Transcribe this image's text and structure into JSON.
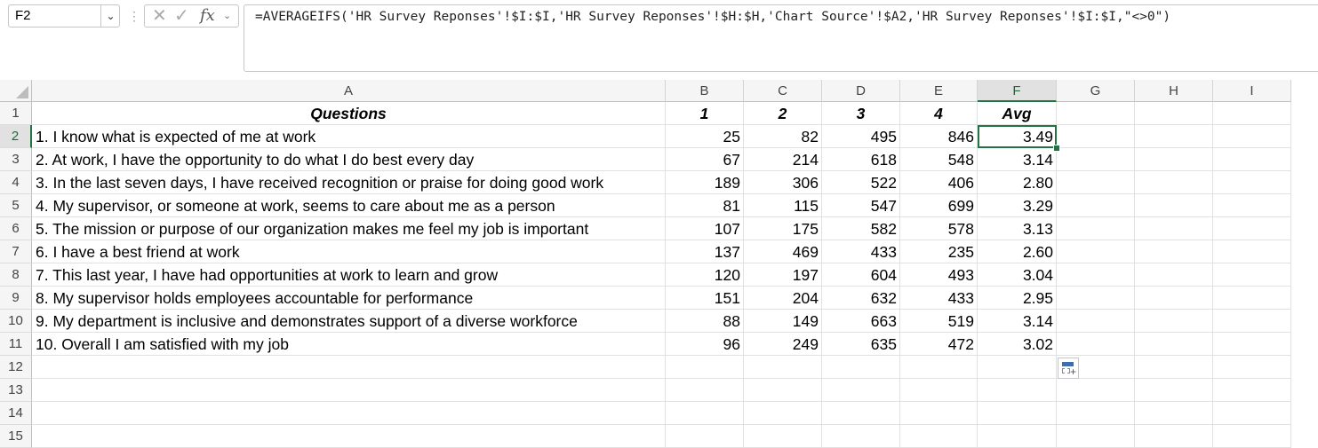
{
  "formula_bar": {
    "name_box": "F2",
    "formula": "=AVERAGEIFS('HR Survey Reponses'!$I:$I,'HR Survey Reponses'!$H:$H,'Chart Source'!$A2,'HR Survey Reponses'!$I:$I,\"<>0\")",
    "fx_label": "fx"
  },
  "columns": [
    "A",
    "B",
    "C",
    "D",
    "E",
    "F",
    "G",
    "H",
    "I"
  ],
  "row_numbers": [
    "1",
    "2",
    "3",
    "4",
    "5",
    "6",
    "7",
    "8",
    "9",
    "10",
    "11",
    "12",
    "13",
    "14",
    "15"
  ],
  "header_row": [
    "Questions",
    "1",
    "2",
    "3",
    "4",
    "Avg"
  ],
  "rows": [
    [
      "1. I know what is expected of me at work",
      "25",
      "82",
      "495",
      "846",
      "3.49"
    ],
    [
      "2. At work, I have the opportunity to do what I do best every day",
      "67",
      "214",
      "618",
      "548",
      "3.14"
    ],
    [
      "3. In the last seven days, I have received recognition or praise for doing good work",
      "189",
      "306",
      "522",
      "406",
      "2.80"
    ],
    [
      "4. My supervisor, or someone at work, seems to care about me as a person",
      "81",
      "115",
      "547",
      "699",
      "3.29"
    ],
    [
      "5. The mission or purpose of our organization makes me feel my job is important",
      "107",
      "175",
      "582",
      "578",
      "3.13"
    ],
    [
      "6. I have a best friend at work",
      "137",
      "469",
      "433",
      "235",
      "2.60"
    ],
    [
      "7. This last year, I have had opportunities at work to learn and grow",
      "120",
      "197",
      "604",
      "493",
      "3.04"
    ],
    [
      "8. My supervisor holds employees accountable for performance",
      "151",
      "204",
      "632",
      "433",
      "2.95"
    ],
    [
      "9. My department is inclusive and demonstrates support of a diverse workforce",
      "88",
      "149",
      "663",
      "519",
      "3.14"
    ],
    [
      "10. Overall I am satisfied with my job",
      "96",
      "249",
      "635",
      "472",
      "3.02"
    ]
  ],
  "selected_cell": "F2",
  "colors": {
    "accent": "#217346"
  }
}
